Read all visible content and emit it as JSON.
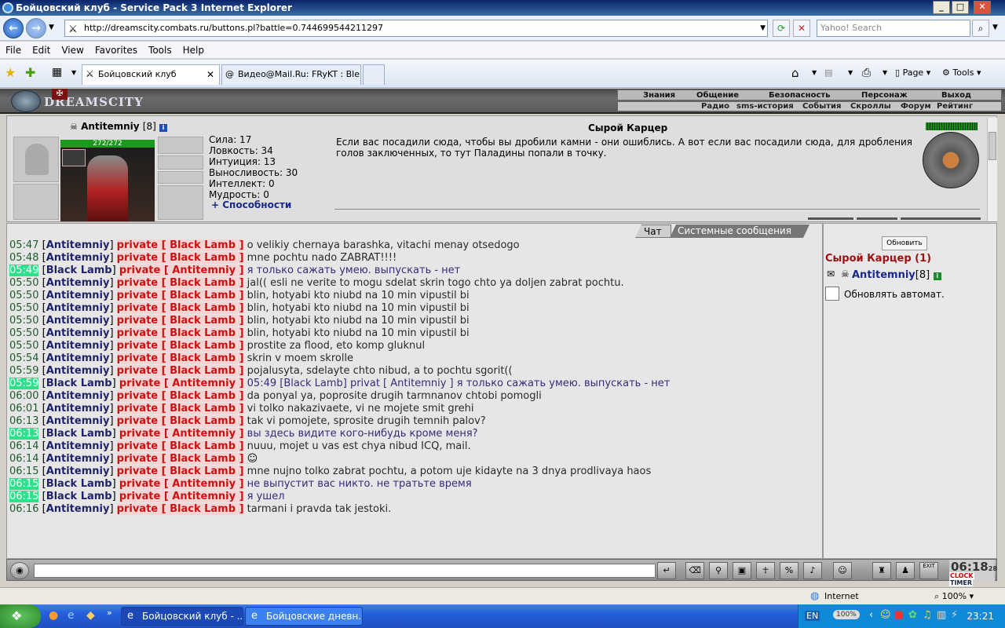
{
  "window": {
    "title": "Бойцовский клуб - Service Pack 3 Internet Explorer"
  },
  "address": {
    "url": "http://dreamscity.combats.ru/buttons.pl?battle=0.744699544211297",
    "search_placeholder": "Yahoo! Search"
  },
  "menu": [
    "File",
    "Edit",
    "View",
    "Favorites",
    "Tools",
    "Help"
  ],
  "tabs": [
    {
      "label": "Бойцовский клуб",
      "active": true
    },
    {
      "label": "Видео@Mail.Ru: FRyKT : Ble...",
      "active": false
    }
  ],
  "ie_toolbar": {
    "page_label": "Page",
    "tools_label": "Tools"
  },
  "game": {
    "logo": "DREAMSCITY",
    "topnav": [
      "Знания",
      "Общение",
      "Безопасность",
      "Персонаж",
      "Выход"
    ],
    "subnav": [
      "Радио",
      "sms-история",
      "События",
      "Скроллы",
      "Форум",
      "Рейтинг"
    ]
  },
  "character": {
    "name": "Antitemniy",
    "level": "[8]",
    "hp": "272/272",
    "stats": [
      "Сила: 17",
      "Ловкость: 34",
      "Интуиция: 13",
      "Выносливость: 30",
      "Интеллект: 0",
      "Мудрость: 0"
    ],
    "abilities_link": "+ Способности"
  },
  "location": {
    "title": "Сырой Карцер",
    "description": "Если вас посадили сюда, чтобы вы дробили камни - они ошиблись. А вот если вас посадили сюда, для дробления голов заключенных, то тут Паладины попали в точку."
  },
  "chat": {
    "tabs": [
      "Чат",
      "Системные сообщения"
    ],
    "lines": [
      {
        "time": "05:47",
        "from": "Antitemniy",
        "to": "Black Lamb",
        "text": "o velikiy chernaya barashka, vitachi menay otsedogo",
        "hl": false
      },
      {
        "time": "05:48",
        "from": "Antitemniy",
        "to": "Black Lamb",
        "text": "mne pochtu nado ZABRAT!!!!",
        "hl": false
      },
      {
        "time": "05:49",
        "from": "Black Lamb",
        "to": "Antitemniy",
        "text": "я только сажать умею. выпускать - нет",
        "hl": true
      },
      {
        "time": "05:50",
        "from": "Antitemniy",
        "to": "Black Lamb",
        "text": "jal(( esli ne verite to mogu sdelat skrin togo chto ya doljen zabrat pochtu.",
        "hl": false
      },
      {
        "time": "05:50",
        "from": "Antitemniy",
        "to": "Black Lamb",
        "text": "blin, hotyabi kto niubd na 10 min vipustil bi",
        "hl": false
      },
      {
        "time": "05:50",
        "from": "Antitemniy",
        "to": "Black Lamb",
        "text": "blin, hotyabi kto niubd na 10 min vipustil bi",
        "hl": false
      },
      {
        "time": "05:50",
        "from": "Antitemniy",
        "to": "Black Lamb",
        "text": "blin, hotyabi kto niubd na 10 min vipustil bi",
        "hl": false
      },
      {
        "time": "05:50",
        "from": "Antitemniy",
        "to": "Black Lamb",
        "text": "blin, hotyabi kto niubd na 10 min vipustil bi",
        "hl": false
      },
      {
        "time": "05:50",
        "from": "Antitemniy",
        "to": "Black Lamb",
        "text": "prostite za flood, eto komp gluknul",
        "hl": false
      },
      {
        "time": "05:54",
        "from": "Antitemniy",
        "to": "Black Lamb",
        "text": "skrin v moem skrolle",
        "hl": false
      },
      {
        "time": "05:59",
        "from": "Antitemniy",
        "to": "Black Lamb",
        "text": "pojalusyta, sdelayte chto nibud, a to pochtu sgorit((",
        "hl": false
      },
      {
        "time": "05:59",
        "from": "Black Lamb",
        "to": "Antitemniy",
        "text": "05:49 [Black Lamb] privat [ Antitemniy ] я только сажать умею. выпускать - нет",
        "hl": true
      },
      {
        "time": "06:00",
        "from": "Antitemniy",
        "to": "Black Lamb",
        "text": "da ponyal ya, poprosite drugih tarmnanov chtobi pomogli",
        "hl": false
      },
      {
        "time": "06:01",
        "from": "Antitemniy",
        "to": "Black Lamb",
        "text": "vi tolko nakazivaete, vi ne mojete smit grehi",
        "hl": false
      },
      {
        "time": "06:13",
        "from": "Antitemniy",
        "to": "Black Lamb",
        "text": "tak vi pomojete, sprosite drugih temnih palov?",
        "hl": false
      },
      {
        "time": "06:13",
        "from": "Black Lamb",
        "to": "Antitemniy",
        "text": "вы здесь видите кого-нибудь кроме меня?",
        "hl": true
      },
      {
        "time": "06:14",
        "from": "Antitemniy",
        "to": "Black Lamb",
        "text": "nuuu, mojet u vas est chya nibud ICQ, mail.",
        "hl": false
      },
      {
        "time": "06:14",
        "from": "Antitemniy",
        "to": "Black Lamb",
        "text": "",
        "hl": false,
        "smiley": true
      },
      {
        "time": "06:15",
        "from": "Antitemniy",
        "to": "Black Lamb",
        "text": "mne nujno tolko zabrat pochtu, a potom uje kidayte na 3 dnya prodlivaya haos",
        "hl": false
      },
      {
        "time": "06:15",
        "from": "Black Lamb",
        "to": "Antitemniy",
        "text": "не выпустит вас никто. не тратьте время",
        "hl": true
      },
      {
        "time": "06:15",
        "from": "Black Lamb",
        "to": "Antitemniy",
        "text": "я ушел",
        "hl": true
      },
      {
        "time": "06:16",
        "from": "Antitemniy",
        "to": "Black Lamb",
        "text": "tarmani i pravda tak jestoki.",
        "hl": false
      }
    ],
    "private_word": "private"
  },
  "online": {
    "refresh_label": "Обновить",
    "room": "Сырой Карцер (1)",
    "user": "Antitemniy",
    "user_level": "[8]",
    "auto_refresh_label": "Обновлять автомат."
  },
  "clock": {
    "time": "06:18",
    "seconds": "28",
    "labels": [
      "CLOCK",
      "TIMER"
    ],
    "exit_label": "EXIT"
  },
  "statusbar": {
    "zone": "Internet",
    "zoom": "100%"
  },
  "taskbar": {
    "tasks": [
      {
        "label": "Бойцовский клуб - ...",
        "active": true
      },
      {
        "label": "Бойцовские дневн...",
        "active": false
      }
    ],
    "lang": "EN",
    "battery": "100%",
    "time": "23:21"
  },
  "colors": {
    "accent": "#cc1111",
    "highlight": "#2ee08a",
    "nick": "#22226a"
  }
}
